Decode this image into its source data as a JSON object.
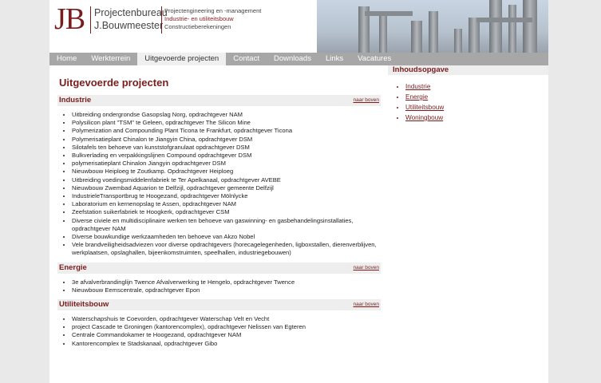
{
  "header": {
    "logo_initials": "JB",
    "company_line1": "Projectenbureau",
    "company_line2": "J.Bouwmeester",
    "tagline_line1": "Projectengineering en -management",
    "tagline_line2": "Industrie- en utiliteitsbouw",
    "tagline_line3": "Constructieberekeningen"
  },
  "nav": {
    "items": [
      "Home",
      "Werkterrein",
      "Uitgevoerde projecten",
      "Contact",
      "Downloads",
      "Links",
      "Vacatures"
    ],
    "active_index": 2
  },
  "main": {
    "title": "Uitgevoerde projecten",
    "top_link": "naar boven",
    "sections": [
      {
        "heading": "Industrie",
        "items": [
          "Uitbreiding ondergrondse Gasopslag Norg, opdrachtgever NAM",
          "Polysilicon plant \"TSM\" te Geleen, opdrachtgever The Silicon Mine",
          "Polymerization and Compounding Plant Ticona te Frankfurt, opdrachtgever Ticona",
          "Polymerisatieplant Chinalon te Jiangyin China, opdrachtgever DSM",
          "Silotafels ten behoeve van kunststofgranulaat opdrachtgever DSM",
          "Bulkverlading en verpakkingslijnen Compound opdrachtgever DSM",
          "polymerisatieplant Chinalon Jiangyin opdrachtgever DSM",
          "Nieuwbouw Heiploeg te Zoutkamp. Opdrachtgever Heiploeg",
          "Uitbreiding voedingsmiddelenfabriek te Ter Apelkanaal, opdrachtgever AVEBE",
          "Nieuwbouw Zwembad Aquarion te Delfzijl, opdrachtgever gemeente Delfzijl",
          "IndustrieleTransportbrug te Hoogezand, opdrachtgever Mölnlycke",
          "Laboratorium en kernenopslag te Assen, opdrachtgever NAM",
          "Zeefstation suikerfabriek te Hoogkerk, opdrachtgever CSM",
          "Diverse civiele en multidisciplinaire werken ten behoeve van gaswinning- en gasbehandelingsinstallaties, opdrachtgever NAM",
          "Diverse bouwkundige werkzaamheden ten behoeve van Akzo Nobel",
          "Vele brandveiligheidsadviezen voor diverse opdrachtgevers (horecagelegenheden, ligboxstallen, dierenverblijven, werkplaatsen, opslaghallen, bijeenkomstruimten, speelhallen, industriegebouwen)"
        ]
      },
      {
        "heading": "Energie",
        "items": [
          "3e afvalverbrandinglijn Twence Afvalverwerking te Hengelo, opdrachtgever Twence",
          "Nieuwbouw Eemscentrale, opdrachtgever Epon"
        ]
      },
      {
        "heading": "Utiliteitsbouw",
        "items": [
          "Waterschapshuis te Coevorden, opdrachtgever Waterschap Velt en Vecht",
          "project Cascade te Groningen (kantorencomplex), opdrachtgever Nelissen van Egteren",
          "Centrale Commandokamer te Hoogezand, opdrachtgever NAM",
          "Kantorencomplex te Stadskanaal, opdrachtgever Gibo"
        ]
      }
    ]
  },
  "sidebar": {
    "heading": "Inhoudsopgave",
    "items": [
      "Industrie",
      "Energie",
      "Utiliteitsbouw",
      "Woningbouw"
    ]
  },
  "colors": {
    "accent": "#7a1c1c",
    "nav_bg": "#a7a7a7",
    "section_bg": "#eeeeee",
    "outer_bg": "#e9e9e9"
  }
}
